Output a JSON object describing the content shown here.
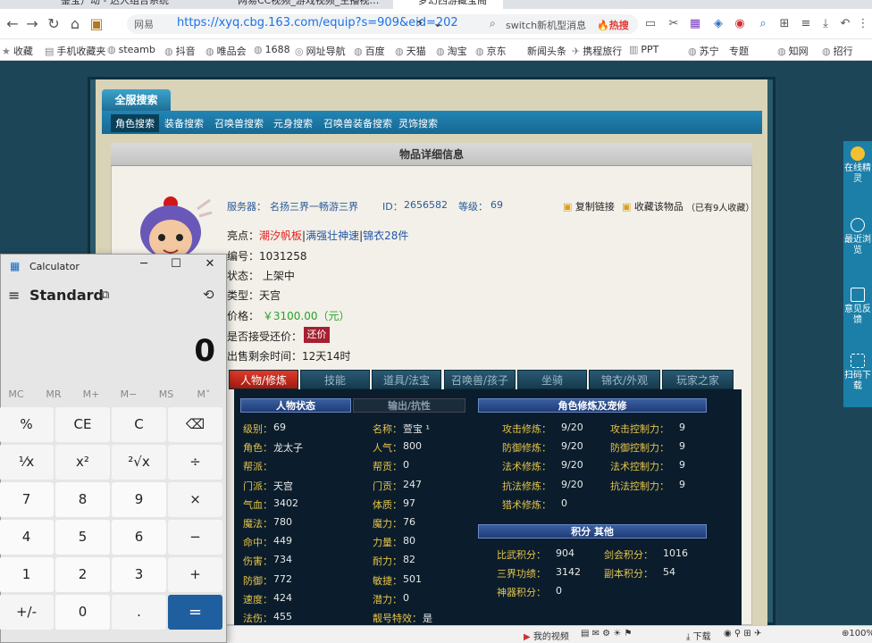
{
  "browser": {
    "tabs": [
      {
        "label": "鉴宝）动 - 达人组合系统"
      },
      {
        "label": "网易CC视频_游戏视频_主播视…"
      },
      {
        "label": "梦幻西游藏宝阁"
      }
    ],
    "site_label": "网易",
    "url": "https://xyq.cbg.163.com/equip?s=909&eid=202",
    "search_query": "switch新机型消息",
    "search_hot": "🔥热搜",
    "bookmarks": [
      "收藏",
      "手机收藏夹",
      "steamb",
      "抖音",
      "唯品会",
      "1688",
      "网址导航",
      "百度",
      "天猫",
      "淘宝",
      "京东",
      "新闻头条",
      "携程旅行",
      "PPT",
      "苏宁",
      "专题",
      "知网",
      "招行"
    ]
  },
  "site": {
    "global_search_tab": "全服搜索",
    "nav": [
      "角色搜索",
      "装备搜索",
      "召唤兽搜索",
      "元身搜索",
      "召唤兽装备搜索",
      "灵饰搜索"
    ],
    "selected_nav": 0,
    "detail_title": "物品详细信息"
  },
  "item": {
    "server_label": "服务器：",
    "server": "名扬三界一畅游三界",
    "id_label": "ID：",
    "id": "2656582",
    "level_label": "等级：",
    "level": "69",
    "copy_link": "复制链接",
    "favorite": "收藏该物品",
    "fav_count": "（已有9人收藏）",
    "highlight_label": "亮点：",
    "highlights": [
      "潮汐帆板",
      "满强壮神速",
      "锦衣28件"
    ],
    "serial_label": "编号：",
    "serial": "1031258",
    "status_label": "状态：",
    "status": "上架中",
    "type_label": "类型：",
    "type": "天宫",
    "price_label": "价格：",
    "price": "￥3100.00（元）",
    "bargain_label": "是否接受还价：",
    "bargain_button": "还价",
    "remaining_label": "出售剩余时间：",
    "remaining": "12天14时"
  },
  "detail_tabs": [
    "人物/修炼",
    "技能",
    "道具/法宝",
    "召唤兽/孩子",
    "坐骑",
    "锦衣/外观",
    "玩家之家"
  ],
  "selected_detail_tab": 0,
  "stats": {
    "section_status": "人物状态",
    "section_output": "输出/抗性",
    "left_col": [
      {
        "label": "级别：",
        "value": "69"
      },
      {
        "label": "角色：",
        "value": "龙太子"
      },
      {
        "label": "帮派：",
        "value": ""
      },
      {
        "label": "门派：",
        "value": "天宫"
      },
      {
        "label": "气血：",
        "value": "3402"
      },
      {
        "label": "魔法：",
        "value": "780"
      },
      {
        "label": "命中：",
        "value": "449"
      },
      {
        "label": "伤害：",
        "value": "734"
      },
      {
        "label": "防御：",
        "value": "772"
      },
      {
        "label": "速度：",
        "value": "424"
      },
      {
        "label": "法伤：",
        "value": "455"
      }
    ],
    "mid_col": [
      {
        "label": "名称：",
        "value": "萱宝 ¹"
      },
      {
        "label": "人气：",
        "value": "800"
      },
      {
        "label": "帮贡：",
        "value": "0"
      },
      {
        "label": "门贡：",
        "value": "247"
      },
      {
        "label": "体质：",
        "value": "97"
      },
      {
        "label": "魔力：",
        "value": "76"
      },
      {
        "label": "力量：",
        "value": "80"
      },
      {
        "label": "耐力：",
        "value": "82"
      },
      {
        "label": "敏捷：",
        "value": "501"
      },
      {
        "label": "潜力：",
        "value": "0"
      },
      {
        "label": "靓号特效：",
        "value": "是"
      }
    ],
    "section_cultivation": "角色修炼及宠修",
    "cultivation": [
      {
        "label": "攻击修炼：",
        "value": "9/20",
        "label2": "攻击控制力：",
        "value2": "9"
      },
      {
        "label": "防御修炼：",
        "value": "9/20",
        "label2": "防御控制力：",
        "value2": "9"
      },
      {
        "label": "法术修炼：",
        "value": "9/20",
        "label2": "法术控制力：",
        "value2": "9"
      },
      {
        "label": "抗法修炼：",
        "value": "9/20",
        "label2": "抗法控制力：",
        "value2": "9"
      },
      {
        "label": "猎术修炼：",
        "value": "0",
        "label2": "",
        "value2": ""
      }
    ],
    "section_score": "积分 其他",
    "scores": [
      {
        "label": "比武积分：",
        "value": "904",
        "label2": "剑会积分：",
        "value2": "1016"
      },
      {
        "label": "三界功绩：",
        "value": "3142",
        "label2": "副本积分：",
        "value2": "54"
      },
      {
        "label": "神器积分：",
        "value": "0",
        "label2": "",
        "value2": ""
      }
    ]
  },
  "sidebar": [
    {
      "label": "在线精灵"
    },
    {
      "label": "最近浏览"
    },
    {
      "label": "意见反馈"
    },
    {
      "label": "扫码下载"
    }
  ],
  "statusbar": {
    "my_video": "我的视频",
    "download": "下载",
    "zoom": "100%"
  },
  "calculator": {
    "title": "Calculator",
    "mode": "Standard",
    "display": "0",
    "memory": [
      "MC",
      "MR",
      "M+",
      "M−",
      "MS",
      "M˅"
    ],
    "keys": [
      [
        "%",
        "CE",
        "C",
        "⌫"
      ],
      [
        "¹⁄x",
        "x²",
        "²√x",
        "÷"
      ],
      [
        "7",
        "8",
        "9",
        "×"
      ],
      [
        "4",
        "5",
        "6",
        "−"
      ],
      [
        "1",
        "2",
        "3",
        "+"
      ],
      [
        "+/-",
        "0",
        ".",
        "="
      ]
    ]
  }
}
